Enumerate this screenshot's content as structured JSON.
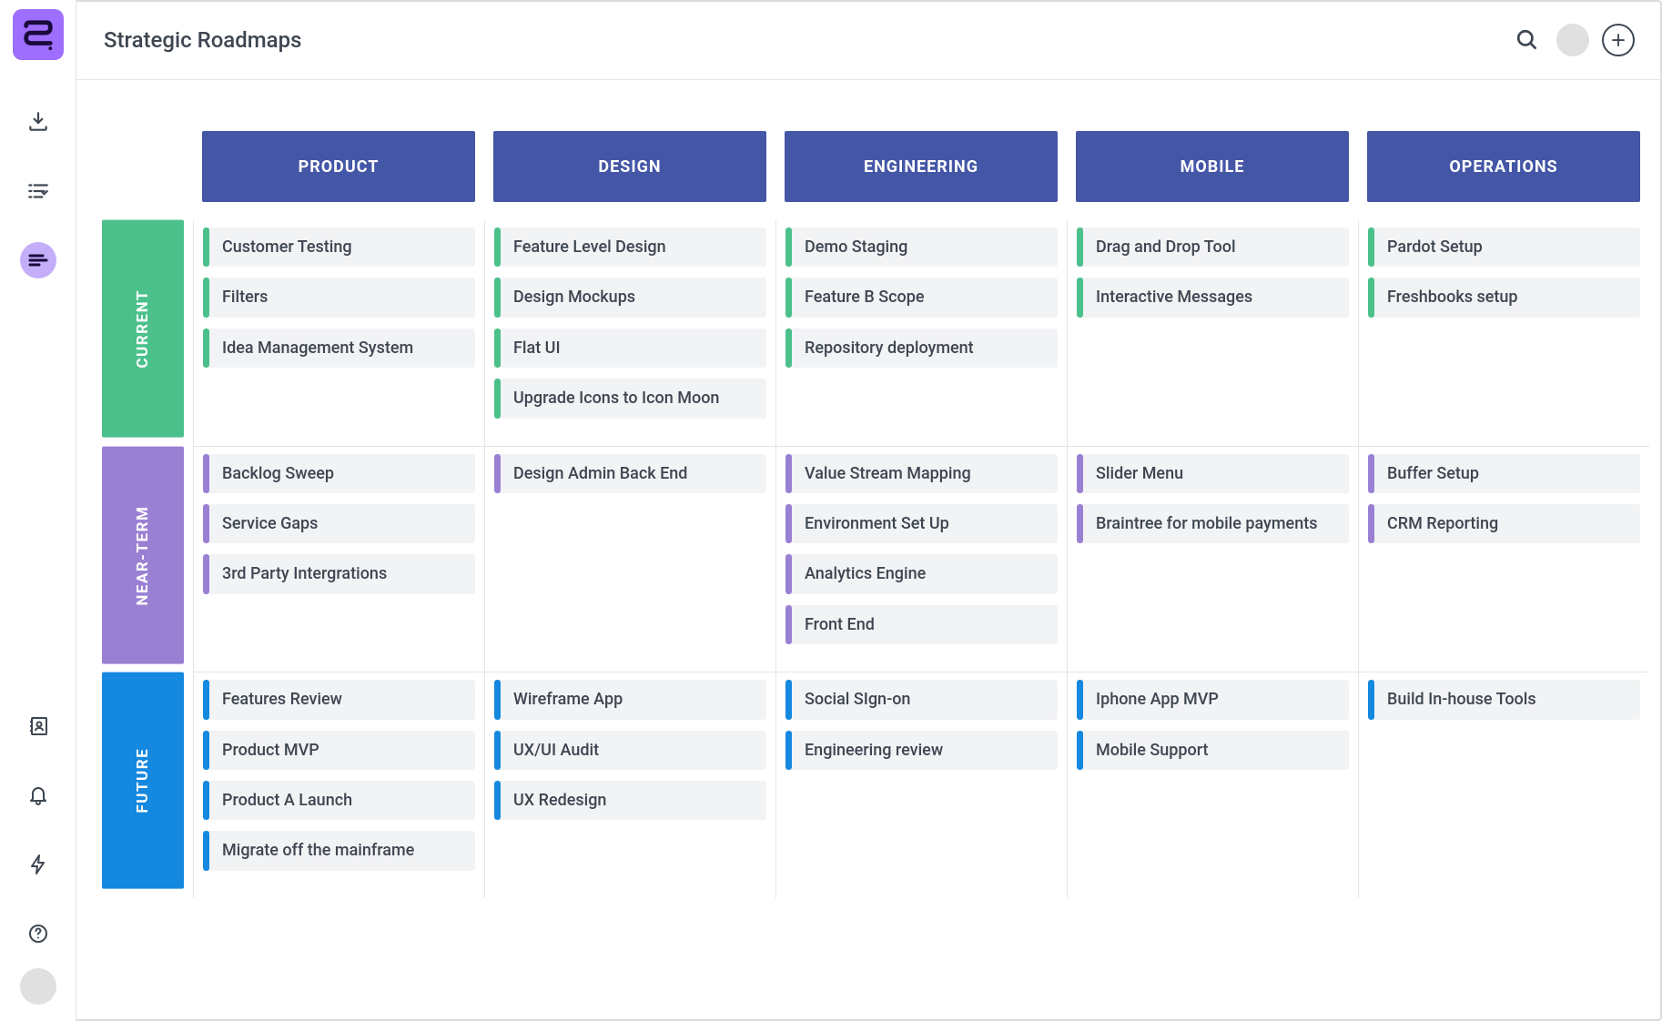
{
  "page_title": "Strategic Roadmaps",
  "columns": [
    "PRODUCT",
    "DESIGN",
    "ENGINEERING",
    "MOBILE",
    "OPERATIONS"
  ],
  "rows": [
    {
      "id": "current",
      "label": "CURRENT",
      "color": "#4bc08b",
      "cells": [
        [
          "Customer Testing",
          "Filters",
          "Idea Management System"
        ],
        [
          "Feature Level Design",
          "Design Mockups",
          "Flat UI",
          "Upgrade Icons to Icon Moon"
        ],
        [
          "Demo Staging",
          "Feature B Scope",
          "Repository deployment"
        ],
        [
          "Drag and Drop Tool",
          "Interactive Messages"
        ],
        [
          "Pardot Setup",
          "Freshbooks setup"
        ]
      ]
    },
    {
      "id": "nearterm",
      "label": "NEAR-TERM",
      "color": "#9a80d3",
      "cells": [
        [
          "Backlog Sweep",
          "Service Gaps",
          "3rd Party Intergrations"
        ],
        [
          "Design Admin Back End"
        ],
        [
          "Value Stream Mapping",
          "Environment Set Up",
          "Analytics Engine",
          "Front End"
        ],
        [
          "Slider Menu",
          "Braintree for mobile payments"
        ],
        [
          "Buffer Setup",
          "CRM Reporting"
        ]
      ]
    },
    {
      "id": "future",
      "label": "FUTURE",
      "color": "#1588df",
      "cells": [
        [
          "Features Review",
          "Product MVP",
          "Product A Launch",
          "Migrate off the mainframe"
        ],
        [
          "Wireframe App",
          "UX/UI Audit",
          "UX Redesign"
        ],
        [
          "Social SIgn-on",
          "Engineering review"
        ],
        [
          "Iphone App MVP",
          "Mobile Support"
        ],
        [
          "Build In-house Tools"
        ]
      ]
    }
  ]
}
